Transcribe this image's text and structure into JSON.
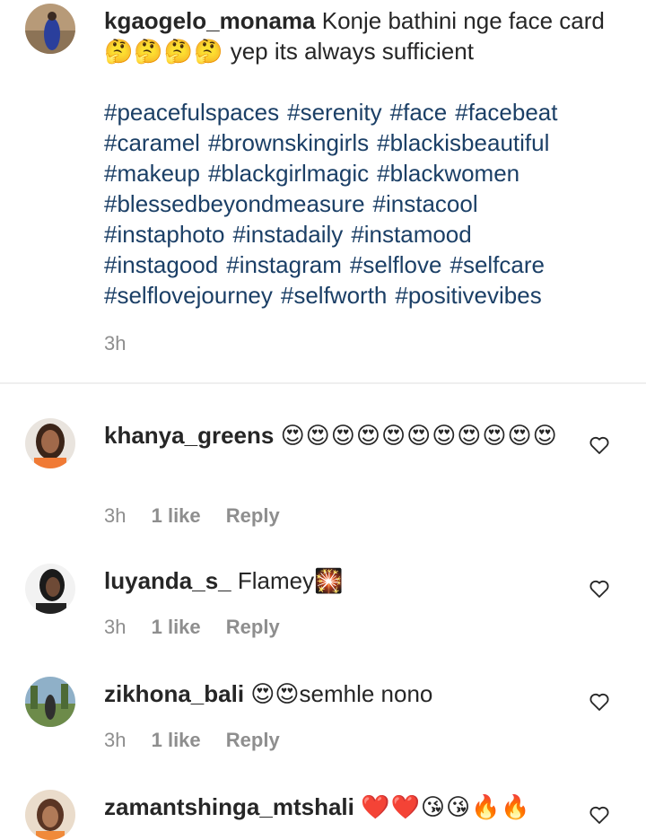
{
  "caption": {
    "username": "kgaogelo_monama",
    "text_before_emoji": "Konje bathini nge face card",
    "emoji": "🤔🤔🤔🤔",
    "text_after_emoji": " yep its always sufficient",
    "hashtags": [
      "#peacefulspaces",
      "#serenity",
      "#face",
      "#facebeat",
      "#caramel",
      "#brownskingirls",
      "#blackisbeautiful",
      "#makeup",
      "#blackgirlmagic",
      "#blackwomen",
      "#blessedbeyondmeasure",
      "#instacool",
      "#instaphoto",
      "#instadaily",
      "#instamood",
      "#instagood",
      "#instagram",
      "#selflove",
      "#selfcare",
      "#selflovejourney",
      "#selfworth",
      "#positivevibes"
    ],
    "time": "3h"
  },
  "comments": [
    {
      "username": "khanya_greens",
      "text": "😍😍😍😍😍😍😍😍😍😍😍",
      "time": "3h",
      "likes": "1 like",
      "reply": "Reply"
    },
    {
      "username": "luyanda_s_",
      "text": "Flamey🎇",
      "time": "3h",
      "likes": "1 like",
      "reply": "Reply"
    },
    {
      "username": "zikhona_bali",
      "text": "😍😍semhle nono",
      "time": "3h",
      "likes": "1 like",
      "reply": "Reply"
    },
    {
      "username": "zamantshinga_mtshali",
      "text": "❤️❤️😘😘🔥🔥",
      "time": "",
      "likes": "",
      "reply": ""
    }
  ],
  "colors": {
    "hashtag": "#1b3f66",
    "muted": "#8e8e8e",
    "text": "#262626",
    "divider": "#efefef"
  },
  "icons": {
    "like": "heart-outline-icon"
  }
}
